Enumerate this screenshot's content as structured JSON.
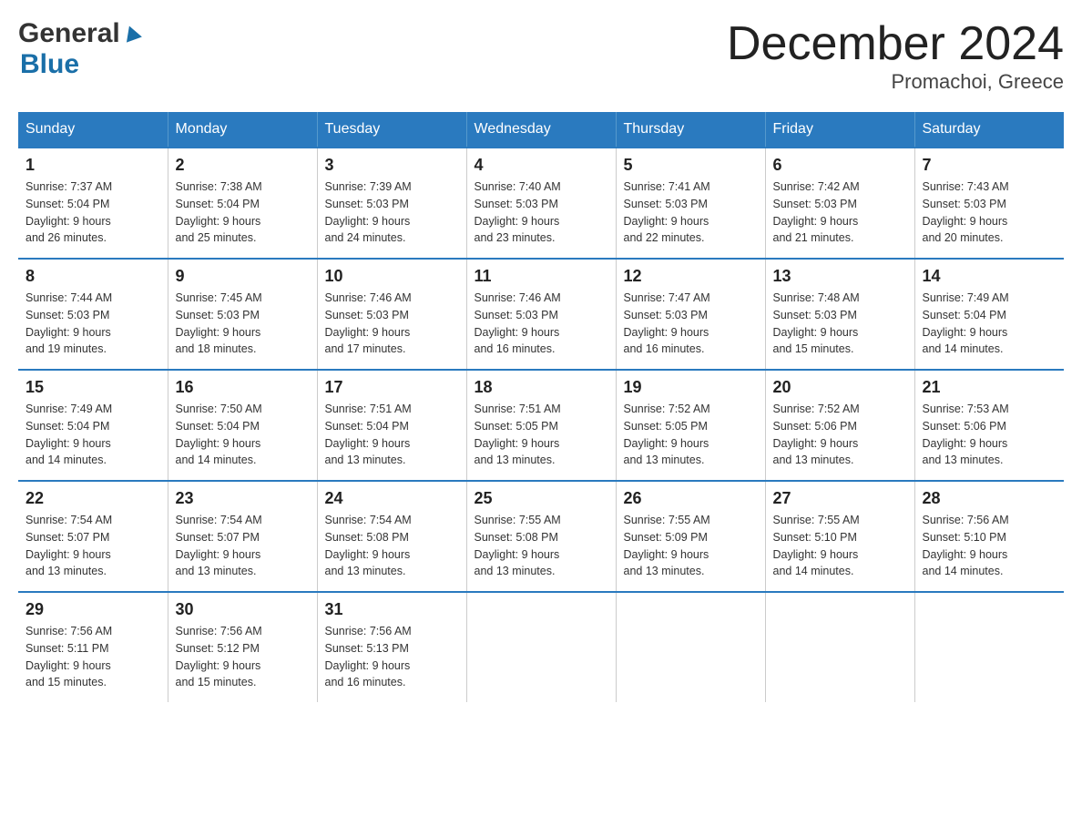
{
  "logo": {
    "general": "General",
    "blue": "Blue"
  },
  "title": "December 2024",
  "location": "Promachoi, Greece",
  "days_of_week": [
    "Sunday",
    "Monday",
    "Tuesday",
    "Wednesday",
    "Thursday",
    "Friday",
    "Saturday"
  ],
  "weeks": [
    [
      {
        "day": "1",
        "sunrise": "7:37 AM",
        "sunset": "5:04 PM",
        "daylight": "9 hours and 26 minutes."
      },
      {
        "day": "2",
        "sunrise": "7:38 AM",
        "sunset": "5:04 PM",
        "daylight": "9 hours and 25 minutes."
      },
      {
        "day": "3",
        "sunrise": "7:39 AM",
        "sunset": "5:03 PM",
        "daylight": "9 hours and 24 minutes."
      },
      {
        "day": "4",
        "sunrise": "7:40 AM",
        "sunset": "5:03 PM",
        "daylight": "9 hours and 23 minutes."
      },
      {
        "day": "5",
        "sunrise": "7:41 AM",
        "sunset": "5:03 PM",
        "daylight": "9 hours and 22 minutes."
      },
      {
        "day": "6",
        "sunrise": "7:42 AM",
        "sunset": "5:03 PM",
        "daylight": "9 hours and 21 minutes."
      },
      {
        "day": "7",
        "sunrise": "7:43 AM",
        "sunset": "5:03 PM",
        "daylight": "9 hours and 20 minutes."
      }
    ],
    [
      {
        "day": "8",
        "sunrise": "7:44 AM",
        "sunset": "5:03 PM",
        "daylight": "9 hours and 19 minutes."
      },
      {
        "day": "9",
        "sunrise": "7:45 AM",
        "sunset": "5:03 PM",
        "daylight": "9 hours and 18 minutes."
      },
      {
        "day": "10",
        "sunrise": "7:46 AM",
        "sunset": "5:03 PM",
        "daylight": "9 hours and 17 minutes."
      },
      {
        "day": "11",
        "sunrise": "7:46 AM",
        "sunset": "5:03 PM",
        "daylight": "9 hours and 16 minutes."
      },
      {
        "day": "12",
        "sunrise": "7:47 AM",
        "sunset": "5:03 PM",
        "daylight": "9 hours and 16 minutes."
      },
      {
        "day": "13",
        "sunrise": "7:48 AM",
        "sunset": "5:03 PM",
        "daylight": "9 hours and 15 minutes."
      },
      {
        "day": "14",
        "sunrise": "7:49 AM",
        "sunset": "5:04 PM",
        "daylight": "9 hours and 14 minutes."
      }
    ],
    [
      {
        "day": "15",
        "sunrise": "7:49 AM",
        "sunset": "5:04 PM",
        "daylight": "9 hours and 14 minutes."
      },
      {
        "day": "16",
        "sunrise": "7:50 AM",
        "sunset": "5:04 PM",
        "daylight": "9 hours and 14 minutes."
      },
      {
        "day": "17",
        "sunrise": "7:51 AM",
        "sunset": "5:04 PM",
        "daylight": "9 hours and 13 minutes."
      },
      {
        "day": "18",
        "sunrise": "7:51 AM",
        "sunset": "5:05 PM",
        "daylight": "9 hours and 13 minutes."
      },
      {
        "day": "19",
        "sunrise": "7:52 AM",
        "sunset": "5:05 PM",
        "daylight": "9 hours and 13 minutes."
      },
      {
        "day": "20",
        "sunrise": "7:52 AM",
        "sunset": "5:06 PM",
        "daylight": "9 hours and 13 minutes."
      },
      {
        "day": "21",
        "sunrise": "7:53 AM",
        "sunset": "5:06 PM",
        "daylight": "9 hours and 13 minutes."
      }
    ],
    [
      {
        "day": "22",
        "sunrise": "7:54 AM",
        "sunset": "5:07 PM",
        "daylight": "9 hours and 13 minutes."
      },
      {
        "day": "23",
        "sunrise": "7:54 AM",
        "sunset": "5:07 PM",
        "daylight": "9 hours and 13 minutes."
      },
      {
        "day": "24",
        "sunrise": "7:54 AM",
        "sunset": "5:08 PM",
        "daylight": "9 hours and 13 minutes."
      },
      {
        "day": "25",
        "sunrise": "7:55 AM",
        "sunset": "5:08 PM",
        "daylight": "9 hours and 13 minutes."
      },
      {
        "day": "26",
        "sunrise": "7:55 AM",
        "sunset": "5:09 PM",
        "daylight": "9 hours and 13 minutes."
      },
      {
        "day": "27",
        "sunrise": "7:55 AM",
        "sunset": "5:10 PM",
        "daylight": "9 hours and 14 minutes."
      },
      {
        "day": "28",
        "sunrise": "7:56 AM",
        "sunset": "5:10 PM",
        "daylight": "9 hours and 14 minutes."
      }
    ],
    [
      {
        "day": "29",
        "sunrise": "7:56 AM",
        "sunset": "5:11 PM",
        "daylight": "9 hours and 15 minutes."
      },
      {
        "day": "30",
        "sunrise": "7:56 AM",
        "sunset": "5:12 PM",
        "daylight": "9 hours and 15 minutes."
      },
      {
        "day": "31",
        "sunrise": "7:56 AM",
        "sunset": "5:13 PM",
        "daylight": "9 hours and 16 minutes."
      },
      null,
      null,
      null,
      null
    ]
  ],
  "labels": {
    "sunrise": "Sunrise: ",
    "sunset": "Sunset: ",
    "daylight": "Daylight: "
  }
}
